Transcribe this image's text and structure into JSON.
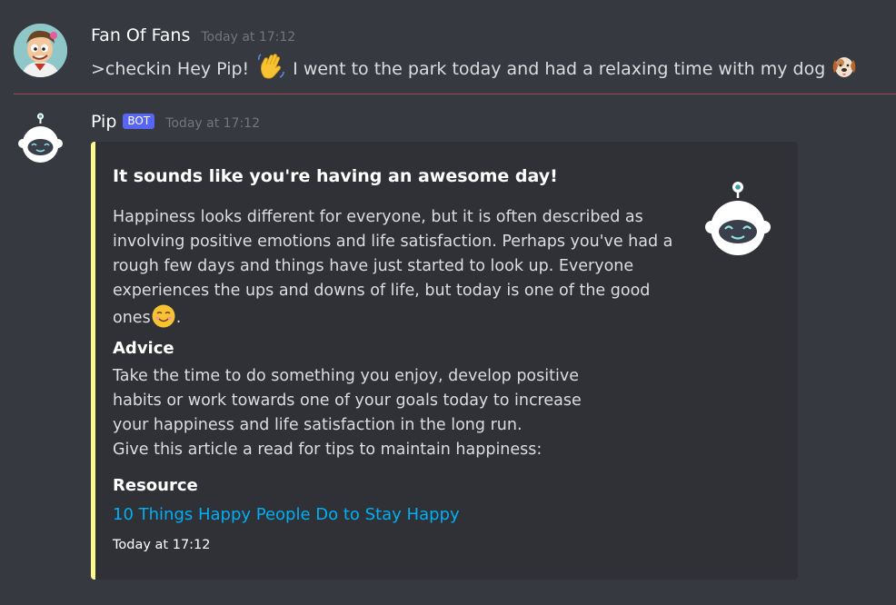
{
  "messages": [
    {
      "username": "Fan Of Fans",
      "timestamp": "Today at 17:12",
      "content_before": ">checkin Hey Pip!",
      "content_after": "I went to the park today and had a relaxing time with my dog",
      "emojis": [
        "waving-hand",
        "dog-face"
      ]
    },
    {
      "username": "Pip",
      "bot_tag": "BOT",
      "timestamp": "Today at 17:12",
      "embed": {
        "accent_color": "#fcfa8c",
        "title": "It sounds like you're having an awesome day!",
        "description_lines": [
          "Happiness looks different for everyone, but it is often described as",
          "involving positive emotions and life satisfaction. Perhaps you've had a",
          "rough few days and things have just started to look up. Everyone",
          "experiences the ups and downs of life, but today is one of the good"
        ],
        "description_last": "ones",
        "description_end": ".",
        "advice_label": "Advice",
        "advice_lines": [
          "Take the time to do something you enjoy, develop positive",
          "habits or work towards one of your goals today to increase",
          "your happiness and life satisfaction in the long run.",
          "Give this article a read for tips to maintain happiness:"
        ],
        "resource_label": "Resource",
        "resource_link": "10 Things Happy People Do to Stay Happy",
        "footer": "Today at 17:12"
      }
    }
  ],
  "colors": {
    "background": "#36393f",
    "embed_bg": "#2f3136",
    "link": "#00aff4",
    "bot_tag": "#5865f2",
    "new_divider": "#a7474b"
  }
}
